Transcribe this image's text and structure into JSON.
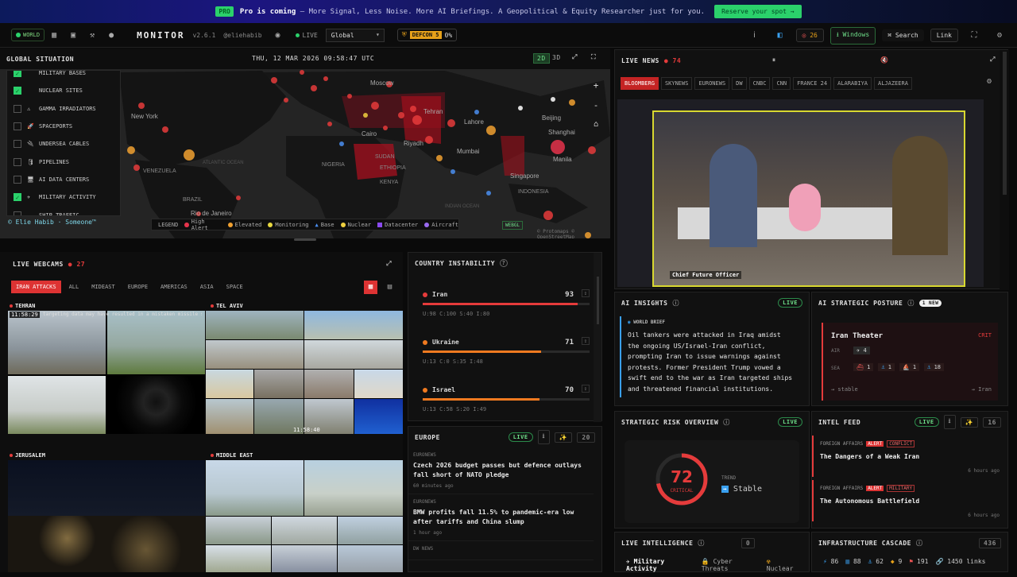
{
  "promo": {
    "badge": "PRO",
    "headline": "Pro is coming",
    "text": " – More Signal, Less Noise. More AI Briefings. A Geopolitical & Equity Researcher just for you.",
    "button": "Reserve your spot →"
  },
  "nav": {
    "world_label": "WORLD",
    "brand": "MONITOR",
    "version": "v2.6.1",
    "handle": "@eliehabib",
    "live": "LIVE",
    "region_select": "Global",
    "defcon_label": "DEFCON 5",
    "defcon_pct": "0%",
    "alerts_count": "26",
    "windows_label": "Windows",
    "search_label": "Search",
    "link_label": "Link"
  },
  "map": {
    "title": "GLOBAL SITUATION",
    "datetime": "THU, 12 MAR 2026 09:58:47 UTC",
    "mode_2d": "2D",
    "mode_3d": "3D",
    "attribution": "© Protomaps © OpenStreetMap",
    "renderer": "WEBGL",
    "footer_credit": "© Elie Habib · Someone™",
    "places": [
      "Moscow",
      "New York",
      "Beijing",
      "Shanghai",
      "Cairo",
      "Riyadh",
      "Tehran",
      "Lahore",
      "Mumbai",
      "Manila",
      "VENEZUELA",
      "BRAZIL",
      "Rio de Janeiro",
      "KENYA",
      "SUDAN",
      "Singapore",
      "INDONESIA",
      "ETHIOPIA",
      "ATLANTIC OCEAN",
      "INDIAN OCEAN",
      "NIGERIA"
    ],
    "layers": [
      {
        "label": "MILITARY BASES",
        "on": true,
        "icon": ""
      },
      {
        "label": "NUCLEAR SITES",
        "on": true,
        "icon": ""
      },
      {
        "label": "GAMMA IRRADIATORS",
        "on": false,
        "icon": "⚠"
      },
      {
        "label": "SPACEPORTS",
        "on": false,
        "icon": "🚀"
      },
      {
        "label": "UNDERSEA CABLES",
        "on": false,
        "icon": "🔌"
      },
      {
        "label": "PIPELINES",
        "on": false,
        "icon": "🛢"
      },
      {
        "label": "AI DATA CENTERS",
        "on": false,
        "icon": "🖥"
      },
      {
        "label": "MILITARY ACTIVITY",
        "on": true,
        "icon": "✈"
      },
      {
        "label": "SHIP TRAFFIC",
        "on": false,
        "icon": ""
      }
    ],
    "legend_title": "LEGEND",
    "legend": [
      {
        "label": "High Alert",
        "color": "#e5334b",
        "shape": "dot"
      },
      {
        "label": "Elevated",
        "color": "#f0a030",
        "shape": "dot"
      },
      {
        "label": "Monitoring",
        "color": "#e8d840",
        "shape": "dot"
      },
      {
        "label": "Base",
        "color": "#4a8ef0",
        "shape": "tri"
      },
      {
        "label": "Nuclear",
        "color": "#f0d040",
        "shape": "dot"
      },
      {
        "label": "Datacenter",
        "color": "#8a4af0",
        "shape": "sq"
      },
      {
        "label": "Aircraft",
        "color": "#9a6af0",
        "shape": "dot"
      }
    ]
  },
  "webcams": {
    "title": "LIVE WEBCAMS",
    "count": "27",
    "filters": [
      "IRAN ATTACKS",
      "ALL",
      "MIDEAST",
      "EUROPE",
      "AMERICAS",
      "ASIA",
      "SPACE"
    ],
    "cams": [
      "TEHRAN",
      "TEL AVIV",
      "JERUSALEM",
      "MIDDLE EAST"
    ],
    "tehran_time": "11:58:29",
    "telaviv_time": "11:58:40",
    "ticker": "targeting data may have resulted in a mistaken missile strike, according to the ..."
  },
  "instability": {
    "title": "COUNTRY INSTABILITY",
    "rows": [
      {
        "name": "Iran",
        "score": "93",
        "pct": 0.93,
        "color": "#e53b3b",
        "sub": "U:98  C:100  S:40  I:80"
      },
      {
        "name": "Ukraine",
        "score": "71",
        "pct": 0.71,
        "color": "#f07a20",
        "sub": "U:13  C:0  S:35  I:48"
      },
      {
        "name": "Israel",
        "score": "70",
        "pct": 0.7,
        "color": "#f07a20",
        "sub": "U:13  C:58  S:20  I:49"
      }
    ]
  },
  "europe": {
    "title": "EUROPE",
    "live": "LIVE",
    "count": "20",
    "items": [
      {
        "src": "EURONEWS",
        "title": "Czech 2026 budget passes but defence outlays fall short of NATO pledge",
        "time": "60 minutes ago"
      },
      {
        "src": "EURONEWS",
        "title": "BMW profits fall 11.5% to pandemic-era low after tariffs and China slump",
        "time": "1 hour ago"
      },
      {
        "src": "DW NEWS",
        "title": "",
        "time": ""
      }
    ]
  },
  "livenews": {
    "title": "LIVE NEWS",
    "count": "74",
    "channels": [
      "BLOOMBERG",
      "SKYNEWS",
      "EURONEWS",
      "DW",
      "CNBC",
      "CNN",
      "FRANCE 24",
      "ALARABIYA",
      "ALJAZEERA"
    ],
    "lower_third": "Chief Future Officer"
  },
  "ai_insights": {
    "title": "AI INSIGHTS",
    "live": "LIVE",
    "brief_label": "WORLD BRIEF",
    "brief": "Oil tankers were attacked in Iraq amidst the ongoing US/Israel-Iran conflict, prompting Iran to issue warnings against protests. Former President Trump vowed a swift end to the war as Iran targeted ships and threatened financial institutions."
  },
  "posture": {
    "title": "AI STRATEGIC POSTURE",
    "new": "1 NEW",
    "theater": "Iran Theater",
    "level": "CRIT",
    "air_label": "AIR",
    "air_val": "4",
    "sea_label": "SEA",
    "sea_vals": [
      "1",
      "1",
      "1",
      "18"
    ],
    "trend": "→ stable",
    "trend_target": "→ Iran"
  },
  "risk": {
    "title": "STRATEGIC RISK OVERVIEW",
    "live": "LIVE",
    "score": "72",
    "score_pct": 0.72,
    "level": "CRITICAL",
    "trend_label": "TREND",
    "trend": "Stable"
  },
  "intel": {
    "title": "INTEL FEED",
    "live": "LIVE",
    "count": "16",
    "items": [
      {
        "cat": "FOREIGN AFFAIRS",
        "alert": "ALERT",
        "tag": "CONFLICT",
        "title": "The Dangers of a Weak Iran",
        "time": "6 hours ago"
      },
      {
        "cat": "FOREIGN AFFAIRS",
        "alert": "ALERT",
        "tag": "MILITARY",
        "title": "The Autonomous Battlefield",
        "time": "6 hours ago"
      }
    ]
  },
  "liveint": {
    "title": "LIVE INTELLIGENCE",
    "count": "0",
    "tabs": [
      "Military Activity",
      "Cyber Threats",
      "Nuclear"
    ]
  },
  "infra": {
    "title": "INFRASTRUCTURE CASCADE",
    "count": "436",
    "stats": [
      "86",
      "88",
      "62",
      "9",
      "191",
      "1450 links"
    ]
  },
  "colors": {
    "accent": "#2bd16b",
    "alert": "#e53b3b",
    "warn": "#f07a20",
    "panel": "#111111"
  }
}
